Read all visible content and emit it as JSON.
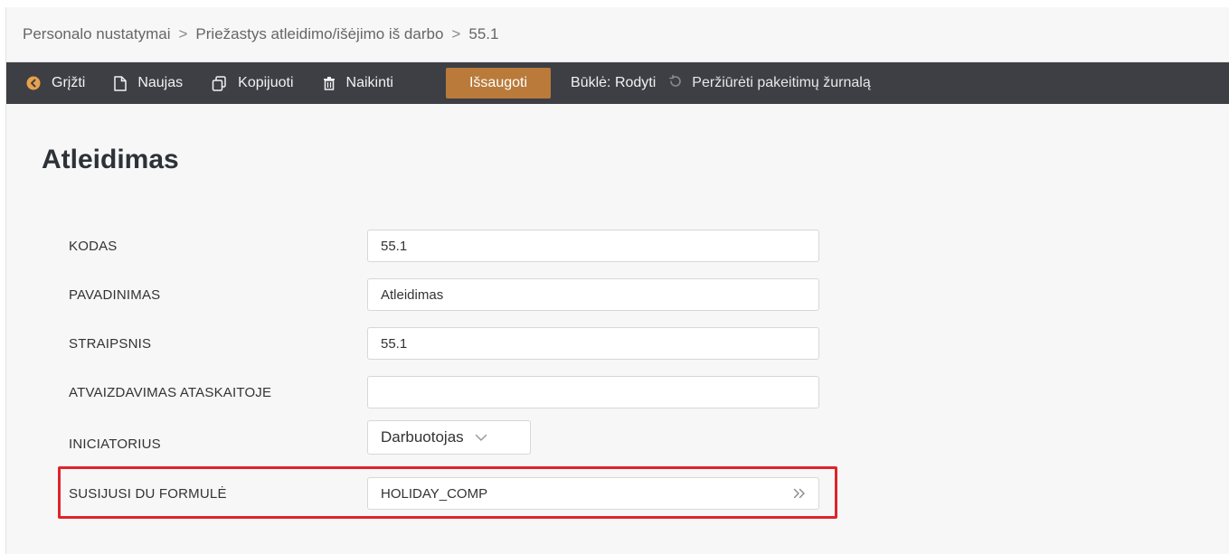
{
  "breadcrumb": {
    "items": [
      "Personalo nustatymai",
      "Priežastys atleidimo/išėjimo iš darbo",
      "55.1"
    ],
    "separator": ">"
  },
  "toolbar": {
    "back_label": "Grįžti",
    "new_label": "Naujas",
    "copy_label": "Kopijuoti",
    "delete_label": "Naikinti",
    "save_label": "Išsaugoti",
    "status_label": "Būklė: Rodyti",
    "history_label": "Peržiūrėti pakeitimų žurnalą",
    "colors": {
      "background": "#3d3f45",
      "save_button": "#b97a3a",
      "back_icon": "#e8a24a"
    }
  },
  "page": {
    "title": "Atleidimas"
  },
  "form": {
    "kodas": {
      "label": "KODAS",
      "value": "55.1"
    },
    "pavadinimas": {
      "label": "PAVADINIMAS",
      "value": "Atleidimas"
    },
    "straipsnis": {
      "label": "STRAIPSNIS",
      "value": "55.1"
    },
    "atvaizdavimas": {
      "label": "ATVAIZDAVIMAS ATASKAITOJE",
      "value": ""
    },
    "iniciatorius": {
      "label": "INICIATORIUS",
      "value": "Darbuotojas"
    },
    "formule": {
      "label": "SUSIJUSI DU FORMULĖ",
      "value": "HOLIDAY_COMP",
      "action_icon": "double-chevron-right-icon"
    },
    "highlight_color": "#e0232b"
  }
}
